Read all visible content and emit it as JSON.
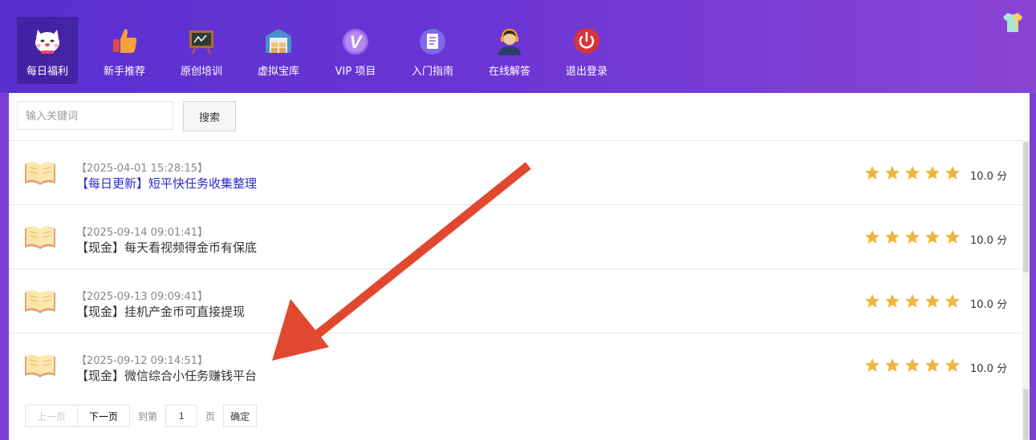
{
  "nav": {
    "items": [
      {
        "label": "每日福利",
        "icon": "lucky-cat-icon",
        "active": true
      },
      {
        "label": "新手推荐",
        "icon": "thumbs-up-icon"
      },
      {
        "label": "原创培训",
        "icon": "blackboard-icon"
      },
      {
        "label": "虚拟宝库",
        "icon": "warehouse-icon"
      },
      {
        "label": "VIP 项目",
        "icon": "vip-badge-icon"
      },
      {
        "label": "入门指南",
        "icon": "document-icon"
      },
      {
        "label": "在线解答",
        "icon": "support-agent-icon"
      },
      {
        "label": "退出登录",
        "icon": "power-icon"
      }
    ]
  },
  "search": {
    "placeholder": "输入关键词",
    "button_label": "搜索"
  },
  "articles": [
    {
      "date": "【2025-04-01 15:28:15】",
      "title": "【每日更新】短平快任务收集整理",
      "rating": 5,
      "score": "10.0 分"
    },
    {
      "date": "【2025-09-14 09:01:41】",
      "title": "【现金】每天看视频得金币有保底",
      "rating": 5,
      "score": "10.0 分"
    },
    {
      "date": "【2025-09-13 09:09:41】",
      "title": "【现金】挂机产金币可直接提现",
      "rating": 5,
      "score": "10.0 分"
    },
    {
      "date": "【2025-09-12 09:14:51】",
      "title": "【现金】微信综合小任务赚钱平台",
      "rating": 5,
      "score": "10.0 分"
    }
  ],
  "pager": {
    "prev": "上一页",
    "next": "下一页",
    "goto_prefix": "到第",
    "page_value": "1",
    "goto_suffix": "页",
    "confirm": "确定"
  },
  "colors": {
    "nav_gradient_start": "#5a2fd0",
    "nav_gradient_end": "#8a44d4",
    "star": "#f2b43c",
    "link": "#2a2ad6",
    "annotation_arrow": "#e0492f"
  }
}
